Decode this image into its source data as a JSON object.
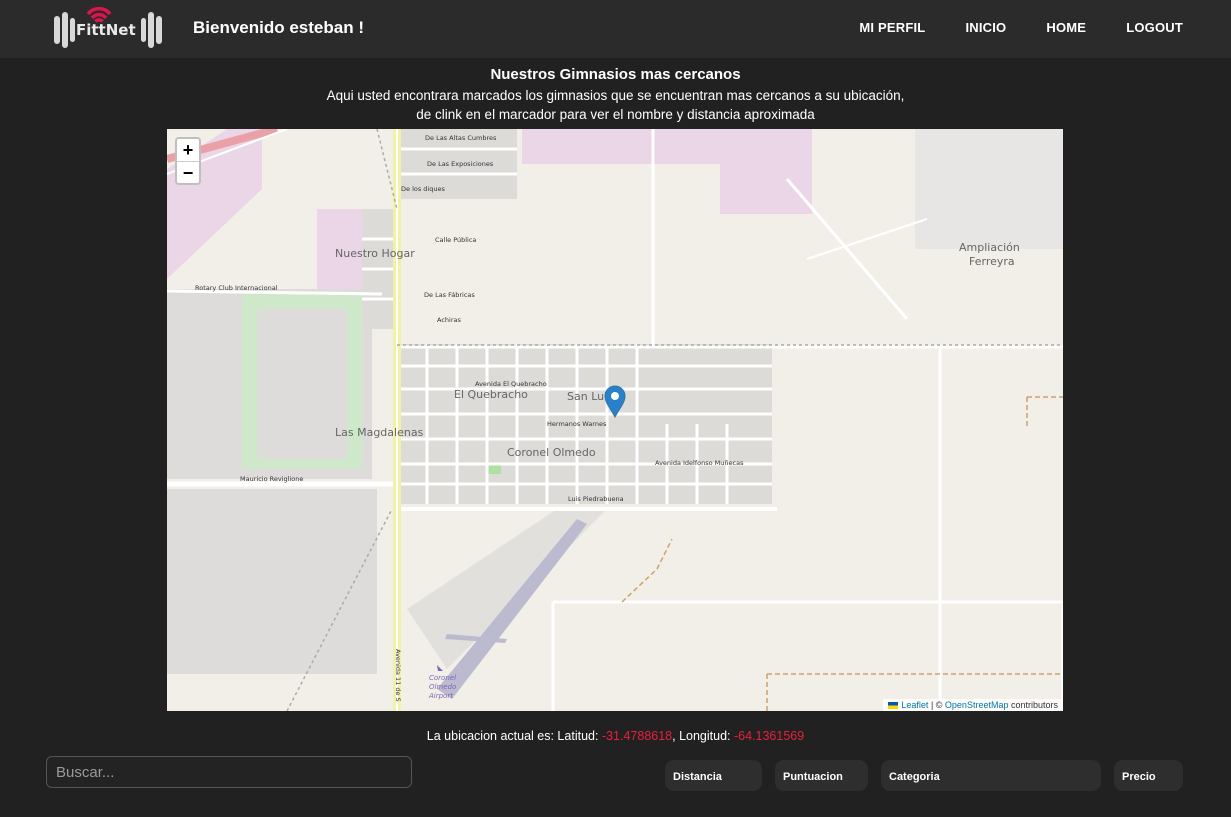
{
  "navbar": {
    "logo_text": "FittNet",
    "welcome": "Bienvenido esteban !",
    "links": [
      "MI PERFIL",
      "INICIO",
      "HOME",
      "LOGOUT"
    ]
  },
  "header": {
    "title": "Nuestros Gimnasios mas cercanos",
    "subtitle_line1": "Aqui usted encontrara marcados los gimnasios que se encuentran mas cercanos a su ubicación,",
    "subtitle_line2": "de clink en el marcador para ver el nombre y distancia aproximada"
  },
  "map": {
    "zoom_in": "+",
    "zoom_out": "−",
    "attribution": {
      "leaflet": "Leaflet",
      "separator": " | © ",
      "osm": "OpenStreetMap",
      "suffix": " contributors"
    },
    "labels": {
      "nuestro_hogar": "Nuestro Hogar",
      "el_quebracho": "El Quebracho",
      "san_luis": "San Luis",
      "las_magdalenas": "Las Magdalenas",
      "coronel_olmedo": "Coronel Olmedo",
      "ampliacion": "Ampliación",
      "ferreyra": "Ferreyra",
      "airport1": "Coronel",
      "airport2": "Olmedo",
      "airport3": "Airport",
      "avenida_quebracho": "Avenida El Quebracho",
      "hermanos_warnes": "Hermanos Warnes",
      "luis_piedrabuena": "Luis Piedrabuena",
      "mauricio_reviglione": "Mauricio Reviglione",
      "rotary": "Rotary Club Internacional",
      "calle_publica": "Calle Pública",
      "de_las_exposiciones": "De Las Exposiciones",
      "de_las_altas_cumbres": "De Las Altas Cumbres",
      "de_las_fabricas": "De Las Fábricas",
      "achiras": "Achiras",
      "avenida_idelfonso": "Avenida Idelfonso Muñecas",
      "de_los_diques": "De los diques",
      "avenida_11": "Avenida 11 de S"
    }
  },
  "location": {
    "prefix": "La ubicacion actual es: Latitud: ",
    "lat": "-31.4788618",
    "mid": ", Longitud: ",
    "lng": "-64.1361569"
  },
  "search": {
    "placeholder": "Buscar..."
  },
  "filters": [
    "Distancia",
    "Puntuacion",
    "Categoria",
    "Precio"
  ],
  "colors": {
    "accent": "#e8203c",
    "navbar_bg": "#2b2b2b",
    "page_bg": "#212121",
    "marker": "#2a81cb"
  }
}
